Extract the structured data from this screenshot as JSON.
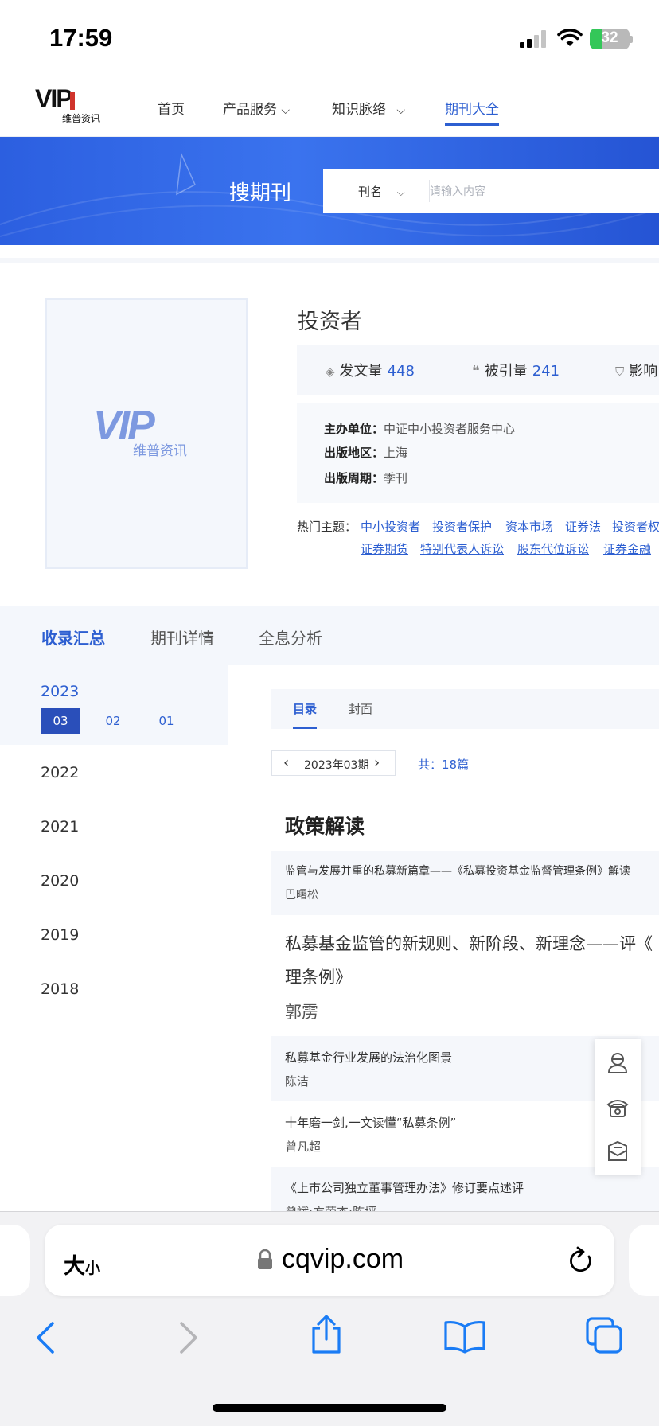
{
  "status_bar": {
    "time": "17:59",
    "battery": "32",
    "battery_level": 0.32
  },
  "logo": {
    "text": "VIP",
    "subtitle": "维普资讯"
  },
  "nav": {
    "items": [
      {
        "label": "首页",
        "dropdown": false
      },
      {
        "label": "产品服务",
        "dropdown": true
      },
      {
        "label": "知识脉络",
        "dropdown": true
      },
      {
        "label": "期刊大全",
        "dropdown": false,
        "active": true
      }
    ]
  },
  "search": {
    "title": "搜期刊",
    "scope": "刊名",
    "placeholder": "请输入内容"
  },
  "journal": {
    "title": "投资者",
    "cover_logo": "VIP",
    "cover_sub": "维普资讯",
    "stats": [
      {
        "label": "发文量",
        "value": "448",
        "icon": "layers-icon"
      },
      {
        "label": "被引量",
        "value": "241",
        "icon": "quote-icon"
      },
      {
        "label": "影响",
        "value": "",
        "icon": "shield-icon"
      }
    ],
    "info": [
      {
        "label": "主办单位：",
        "value": "中证中小投资者服务中心"
      },
      {
        "label": "出版地区：",
        "value": "上海"
      },
      {
        "label": "出版周期：",
        "value": "季刊"
      }
    ],
    "hot_label": "热门主题：",
    "hot_topics_row1": [
      "中小投资者",
      "投资者保护",
      "资本市场",
      "证券法",
      "投资者权"
    ],
    "hot_topics_row2": [
      "证券期货",
      "特别代表人诉讼",
      "股东代位诉讼",
      "证券金融"
    ]
  },
  "tabs": [
    "收录汇总",
    "期刊详情",
    "全息分析"
  ],
  "years": {
    "current": "2023",
    "issues": [
      "03",
      "02",
      "01"
    ],
    "others": [
      "2022",
      "2021",
      "2020",
      "2019",
      "2018"
    ]
  },
  "content": {
    "sub_tabs": [
      "目录",
      "封面"
    ],
    "issue_label": "2023年03期",
    "total": "共：18篇",
    "section": "政策解读",
    "articles": [
      {
        "title": "监管与发展并重的私募新篇章——《私募投资基金监督管理条例》解读",
        "author": "巴曙松"
      },
      {
        "title_line1": "私募基金监管的新规则、新阶段、新理念——评《",
        "title_line2": "理条例》",
        "author": "郭雳"
      },
      {
        "title": "私募基金行业发展的法治化图景",
        "author": "陈洁"
      },
      {
        "title": "十年磨一剑,一文读懂“私募条例”",
        "author": "曾凡超"
      },
      {
        "title": "《上市公司独立董事管理办法》修订要点述评",
        "author": "曾斌;方荣杰;陈坪"
      }
    ]
  },
  "browser": {
    "text_size_big": "大",
    "text_size_small": "小",
    "url": "cqvip.com"
  },
  "colors": {
    "accent": "#2d5fd1",
    "banner": "#2c5fe0",
    "active_issue": "#2a4fba"
  }
}
